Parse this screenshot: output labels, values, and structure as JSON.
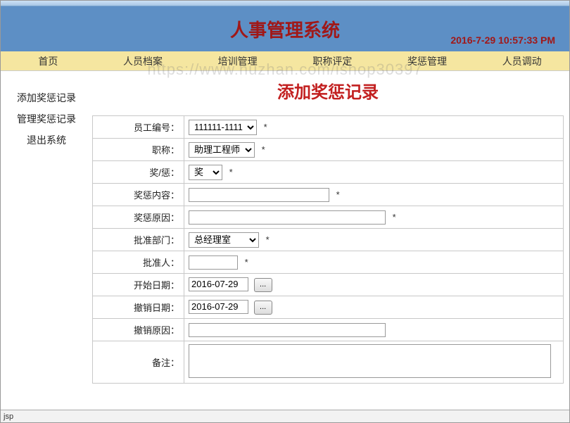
{
  "header": {
    "title": "人事管理系统",
    "timestamp": "2016-7-29 10:57:33 PM"
  },
  "watermark": "https://www.huzhan.com/ishop30397",
  "nav": {
    "items": [
      "首页",
      "人员档案",
      "培训管理",
      "职称评定",
      "奖惩管理",
      "人员调动"
    ]
  },
  "sidebar": {
    "items": [
      "添加奖惩记录",
      "管理奖惩记录",
      "退出系统"
    ]
  },
  "page": {
    "title": "添加奖惩记录"
  },
  "form": {
    "employee_id": {
      "label": "员工编号：",
      "value": "111111-1111",
      "required": "*"
    },
    "title": {
      "label": "职称：",
      "value": "助理工程师",
      "required": "*"
    },
    "reward_type": {
      "label": "奖/惩：",
      "value": "奖",
      "required": "*"
    },
    "content": {
      "label": "奖惩内容：",
      "value": "",
      "required": "*"
    },
    "reason": {
      "label": "奖惩原因：",
      "value": "",
      "required": "*"
    },
    "dept": {
      "label": "批准部门：",
      "value": "总经理室",
      "required": "*"
    },
    "approver": {
      "label": "批准人：",
      "value": "",
      "required": "*"
    },
    "start_date": {
      "label": "开始日期：",
      "value": "2016-07-29",
      "btn": "..."
    },
    "revoke_date": {
      "label": "撤销日期：",
      "value": "2016-07-29",
      "btn": "..."
    },
    "revoke_reason": {
      "label": "撤销原因：",
      "value": ""
    },
    "remark": {
      "label": "备注：",
      "value": ""
    }
  },
  "status": {
    "text": "jsp"
  }
}
